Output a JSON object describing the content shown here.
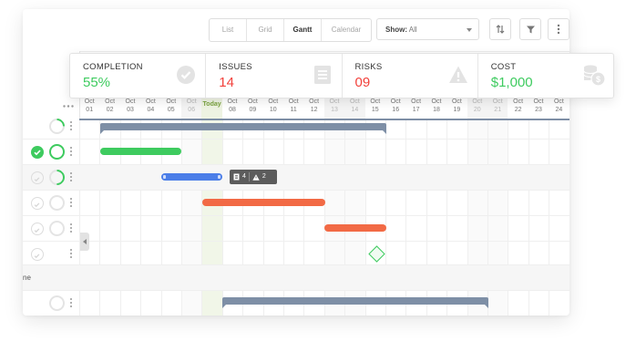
{
  "toolbar": {
    "view_tabs": [
      {
        "label": "List",
        "active": false
      },
      {
        "label": "Grid",
        "active": false
      },
      {
        "label": "Gantt",
        "active": true
      },
      {
        "label": "Calendar",
        "active": false
      }
    ],
    "show_label": "Show:",
    "show_value": "All"
  },
  "stats": [
    {
      "label": "COMPLETION",
      "value": "55%",
      "color": "#3ecb5f",
      "icon": "check-circle-icon"
    },
    {
      "label": "ISSUES",
      "value": "14",
      "color": "#f2413b",
      "icon": "document-icon"
    },
    {
      "label": "RISKS",
      "value": "09",
      "color": "#f2413b",
      "icon": "warning-triangle-icon"
    },
    {
      "label": "COST",
      "value": "$1,000",
      "color": "#3ecb5f",
      "icon": "coins-icon"
    }
  ],
  "timeline": {
    "today_label": "Today",
    "days": [
      {
        "month": "Oct",
        "day": "01"
      },
      {
        "month": "Oct",
        "day": "02"
      },
      {
        "month": "Oct",
        "day": "03"
      },
      {
        "month": "Oct",
        "day": "04"
      },
      {
        "month": "Oct",
        "day": "05"
      },
      {
        "month": "Oct",
        "day": "06",
        "weekend": true
      },
      {
        "month": "",
        "day": "",
        "today": true
      },
      {
        "month": "Oct",
        "day": "08"
      },
      {
        "month": "Oct",
        "day": "09"
      },
      {
        "month": "Oct",
        "day": "10"
      },
      {
        "month": "Oct",
        "day": "11"
      },
      {
        "month": "Oct",
        "day": "12"
      },
      {
        "month": "Oct",
        "day": "13",
        "weekend": true
      },
      {
        "month": "Oct",
        "day": "14",
        "weekend": true
      },
      {
        "month": "Oct",
        "day": "15"
      },
      {
        "month": "Oct",
        "day": "16"
      },
      {
        "month": "Oct",
        "day": "17"
      },
      {
        "month": "Oct",
        "day": "18"
      },
      {
        "month": "Oct",
        "day": "19"
      },
      {
        "month": "Oct",
        "day": "20",
        "weekend": true
      },
      {
        "month": "Oct",
        "day": "21",
        "weekend": true
      },
      {
        "month": "Oct",
        "day": "22"
      },
      {
        "month": "Oct",
        "day": "23"
      },
      {
        "month": "Oct",
        "day": "24"
      }
    ]
  },
  "rows": [
    {
      "status": "none",
      "progress": "tiny",
      "label": ""
    },
    {
      "status": "done",
      "progress": "full",
      "label": ""
    },
    {
      "status": "todo",
      "progress": "half",
      "label": "",
      "highlight": true
    },
    {
      "status": "todo",
      "progress": "empty",
      "label": ""
    },
    {
      "status": "todo",
      "progress": "empty",
      "label": ""
    },
    {
      "status": "todo",
      "progress": "none",
      "label": ""
    },
    {
      "status": "none",
      "progress": "none",
      "label": "ne",
      "highlight": true
    },
    {
      "status": "none",
      "progress": "empty",
      "label": ""
    }
  ],
  "task_counters": {
    "documents": "4",
    "warnings": "2"
  }
}
